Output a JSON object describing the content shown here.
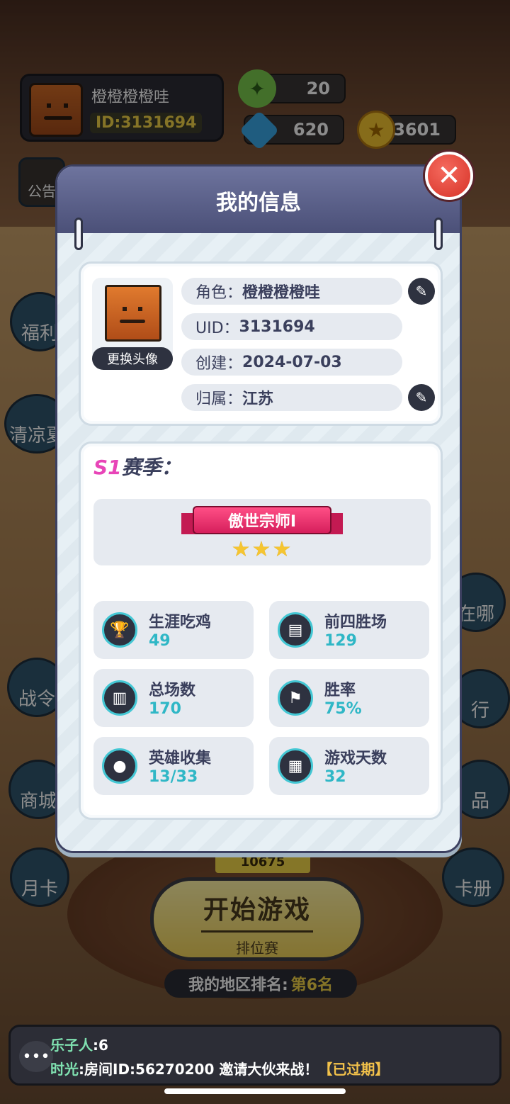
{
  "player": {
    "name": "橙橙橙橙哇",
    "id": "ID:3131694"
  },
  "resources": {
    "stamina": "20",
    "gems": "620",
    "coins": "73601"
  },
  "side_menu": {
    "notice": "公告",
    "welfare": "福利",
    "summer": "清凉夏",
    "battle_pass": "战令",
    "shop": "商城",
    "monthly_card": "月卡",
    "where": "在哪",
    "rank": "行",
    "items": "品",
    "cards": "卡册"
  },
  "modal": {
    "title": "我的信息",
    "change_avatar": "更换头像",
    "role_label": "角色：",
    "role_value": "橙橙橙橙哇",
    "uid_label": "UID：",
    "uid_value": "3131694",
    "created_label": "创建：",
    "created_value": "2024-07-03",
    "region_label": "归属：",
    "region_value": "江苏",
    "season_num": "S1",
    "season_label": "赛季：",
    "rank_title": "傲世宗师I",
    "rank_stars": 3,
    "stats": [
      {
        "name": "生涯吃鸡",
        "value": "49",
        "icon": "trophy-icon"
      },
      {
        "name": "前四胜场",
        "value": "129",
        "icon": "clipboard-icon"
      },
      {
        "name": "总场数",
        "value": "170",
        "icon": "bar-chart-icon"
      },
      {
        "name": "胜率",
        "value": "75%",
        "icon": "flag-icon"
      },
      {
        "name": "英雄收集",
        "value": "13/33",
        "icon": "person-icon"
      },
      {
        "name": "游戏天数",
        "value": "32",
        "icon": "calendar-icon"
      }
    ]
  },
  "game": {
    "score": "10675",
    "start_label": "开始游戏",
    "mode_label": "排位赛",
    "region_rank_label": "我的地区排名:",
    "region_rank_value": "第6名"
  },
  "chat": {
    "line1_name": "乐子人",
    "line1_text": ":6",
    "line2_name": "时光",
    "line2_text": ":房间ID:56270200 邀请大伙来战！",
    "line2_status": "【已过期】"
  },
  "colors": {
    "accent_cyan": "#2fb7c6",
    "season_pink": "#e845b8",
    "close_red": "#d63227",
    "header_purple": "#5a5f8a"
  }
}
